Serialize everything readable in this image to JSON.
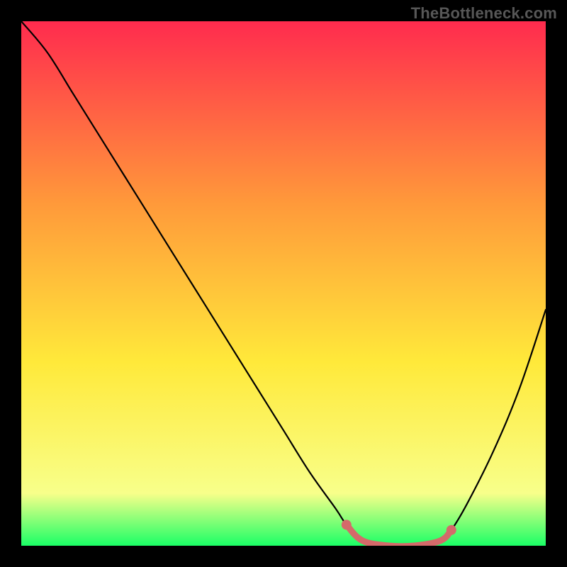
{
  "watermark": "TheBottleneck.com",
  "chart_data": {
    "type": "line",
    "title": "",
    "xlabel": "",
    "ylabel": "",
    "xlim": [
      0,
      100
    ],
    "ylim": [
      0,
      100
    ],
    "grid": false,
    "legend": false,
    "background_gradient": {
      "top": "#ff2b4e",
      "mid1": "#ff9a3a",
      "mid2": "#ffe93a",
      "mid3": "#f8ff8a",
      "bottom": "#1aff66"
    },
    "series": [
      {
        "name": "bottleneck-curve",
        "color": "#000000",
        "x": [
          0,
          5,
          10,
          15,
          20,
          25,
          30,
          35,
          40,
          45,
          50,
          55,
          60,
          62,
          65,
          70,
          75,
          80,
          82,
          85,
          90,
          95,
          100
        ],
        "values": [
          100,
          94,
          86,
          78,
          70,
          62,
          54,
          46,
          38,
          30,
          22,
          14,
          7,
          4,
          1,
          0,
          0,
          1,
          3,
          8,
          18,
          30,
          45
        ]
      },
      {
        "name": "highlight-segment",
        "color": "#d46a6a",
        "x": [
          62,
          65,
          70,
          75,
          80,
          82
        ],
        "values": [
          4,
          1,
          0,
          0,
          1,
          3
        ]
      }
    ],
    "highlight_endpoints": [
      {
        "x": 62,
        "y": 4
      },
      {
        "x": 82,
        "y": 3
      }
    ]
  },
  "colors": {
    "frame": "#000000",
    "curve": "#000000",
    "highlight": "#d46a6a",
    "watermark": "#575757"
  }
}
